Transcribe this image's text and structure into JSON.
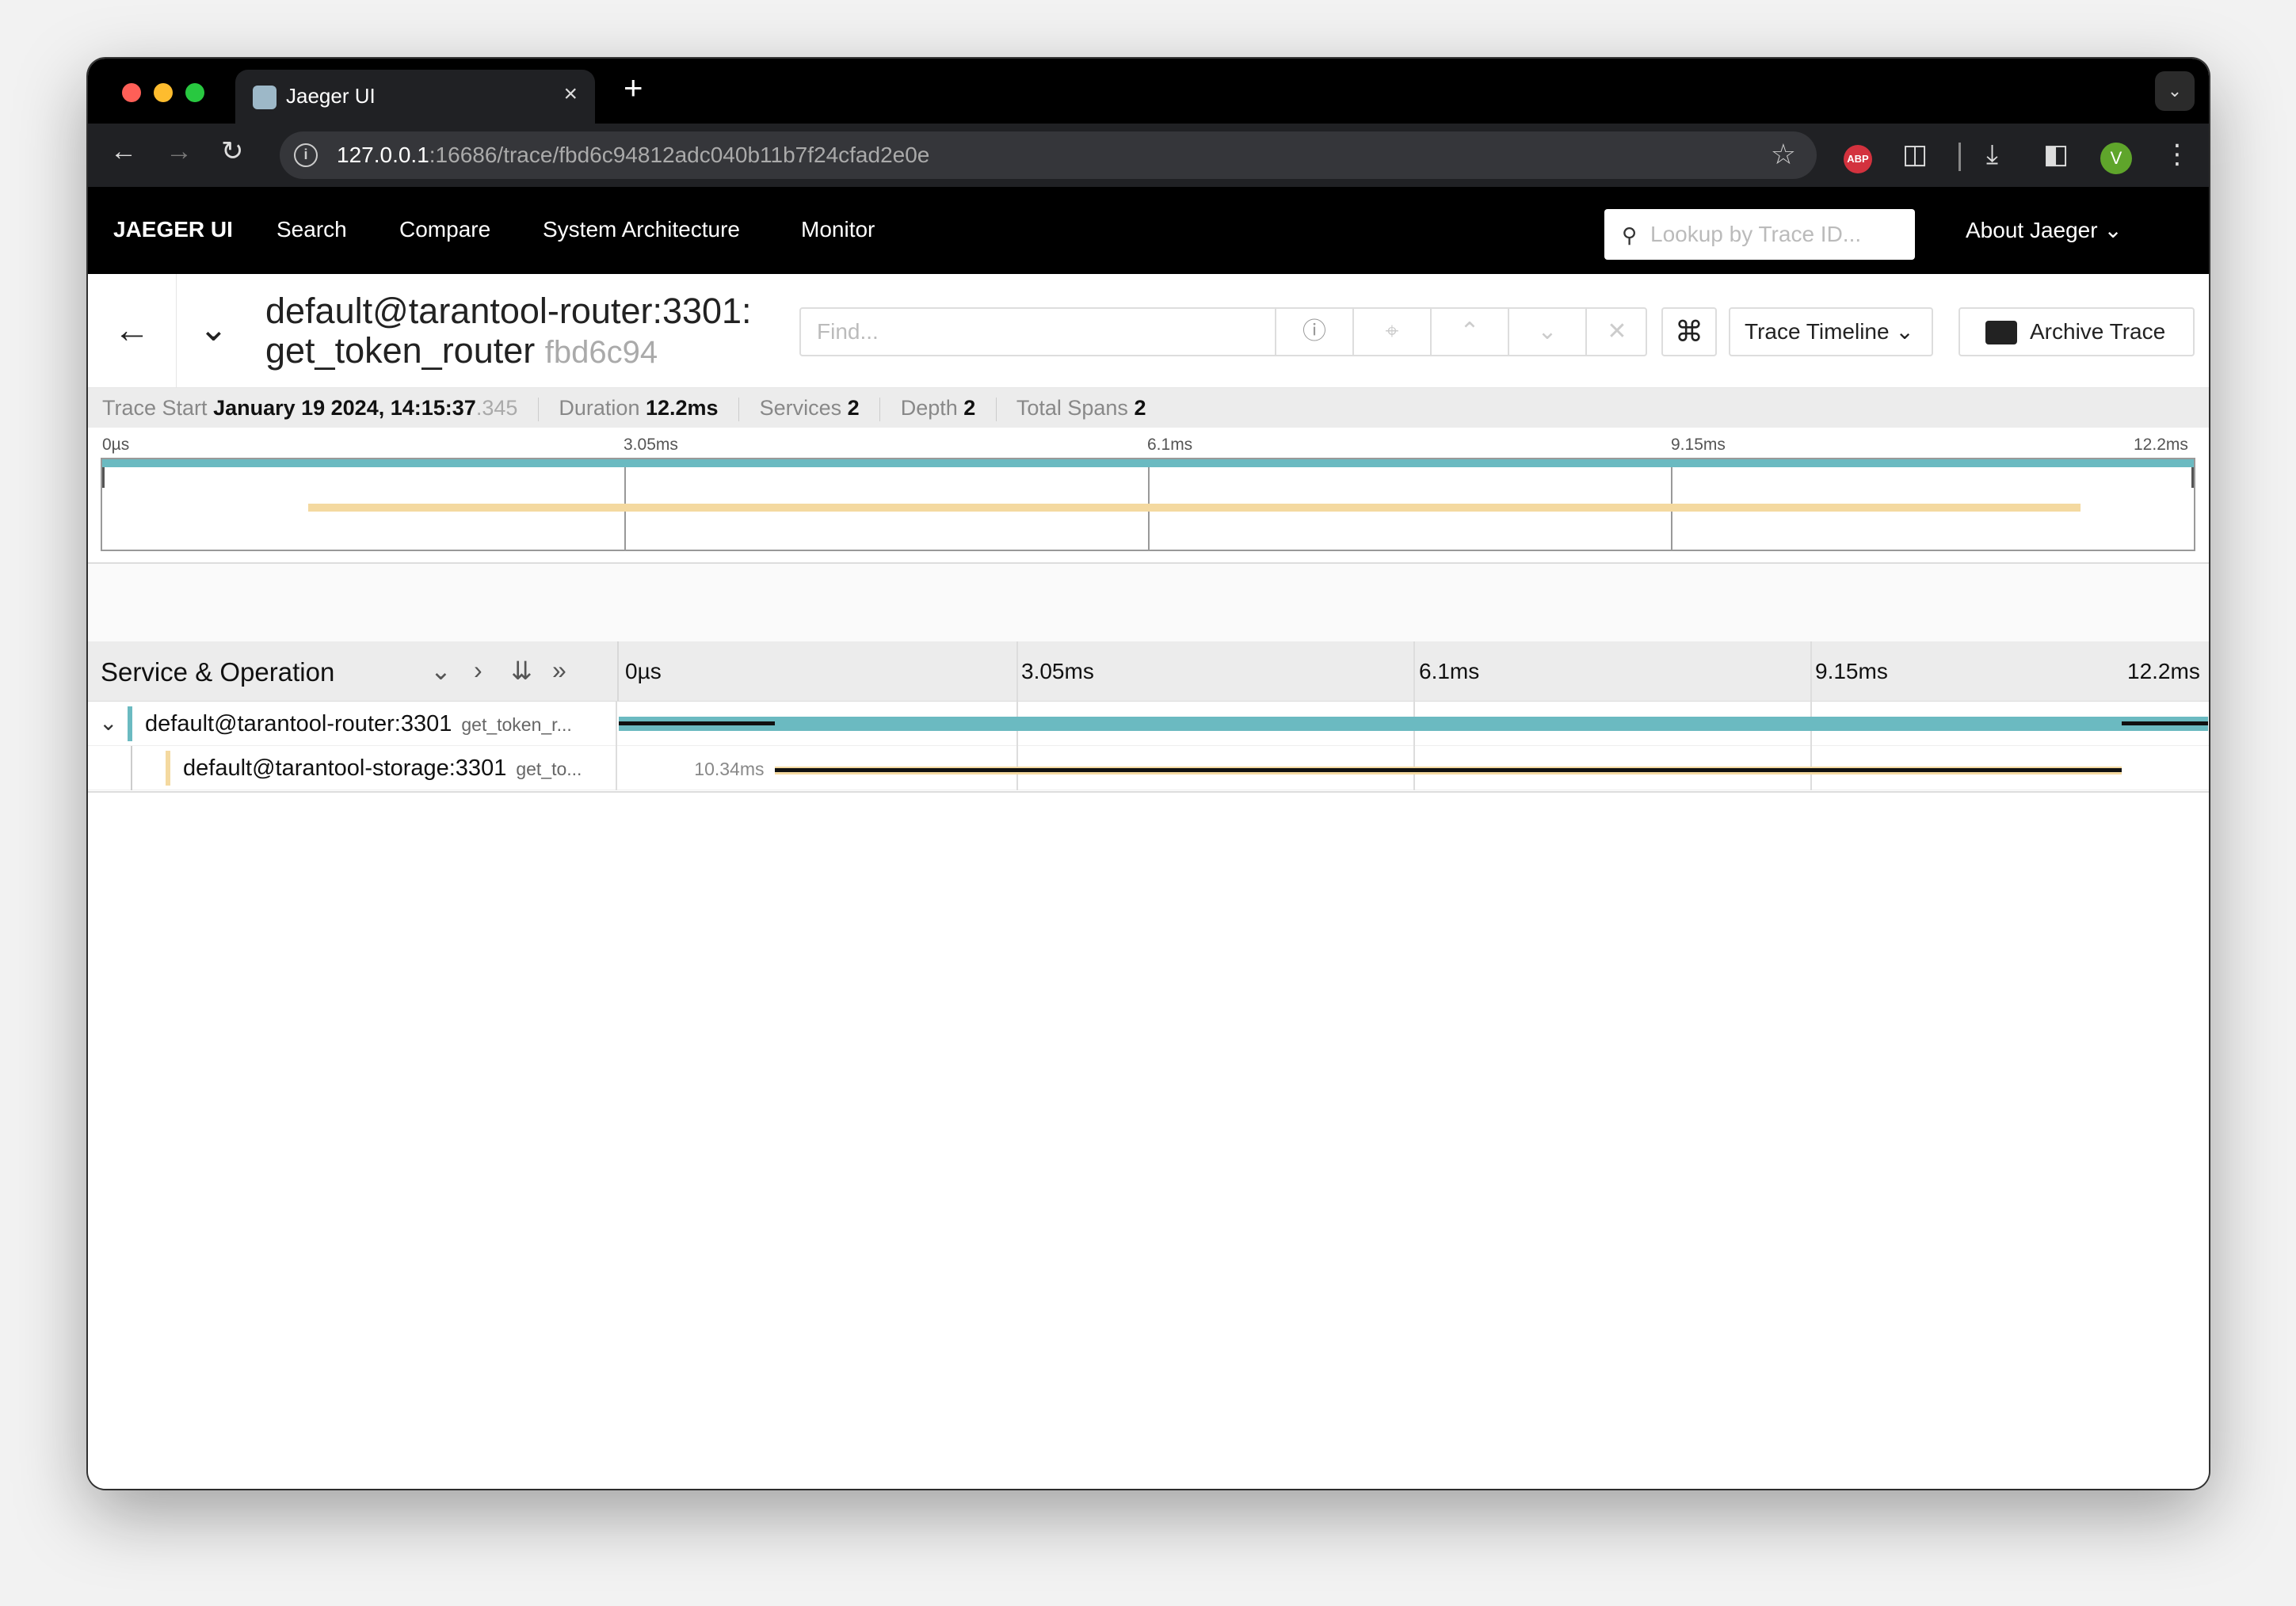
{
  "browser": {
    "tab_title": "Jaeger UI",
    "tab_close": "×",
    "new_tab": "+",
    "url_host": "127.0.0.1",
    "url_rest": ":16686/trace/fbd6c94812adc040b11b7f24cfad2e0e",
    "abp_label": "ABP",
    "profile_initial": "V"
  },
  "topnav": {
    "brand": "JAEGER UI",
    "items": [
      "Search",
      "Compare",
      "System Architecture",
      "Monitor"
    ],
    "lookup_placeholder": "Lookup by Trace ID...",
    "about": "About Jaeger"
  },
  "trace": {
    "title_line1": "default@tarantool-router:3301:",
    "title_line2": "get_token_router",
    "short_id": "fbd6c94",
    "find_placeholder": "Find...",
    "view_mode": "Trace Timeline",
    "archive_label": "Archive Trace"
  },
  "summary": {
    "trace_start_label": "Trace Start",
    "trace_start_value": "January 19 2024, 14:15:37",
    "trace_start_ms": ".345",
    "duration_label": "Duration",
    "duration_value": "12.2ms",
    "services_label": "Services",
    "services_value": "2",
    "depth_label": "Depth",
    "depth_value": "2",
    "total_spans_label": "Total Spans",
    "total_spans_value": "2"
  },
  "minimap": {
    "ticks": [
      "0µs",
      "3.05ms",
      "6.1ms",
      "9.15ms",
      "12.2ms"
    ]
  },
  "timeline": {
    "header_title": "Service & Operation",
    "ticks": [
      "0µs",
      "3.05ms",
      "6.1ms",
      "9.15ms",
      "12.2ms"
    ],
    "total_ms": 12.2,
    "spans": [
      {
        "service": "default@tarantool-router:3301",
        "operation": "get_token_r...",
        "start_ms": 0,
        "duration_ms": 12.2,
        "color": "#6bbac1",
        "label": ""
      },
      {
        "service": "default@tarantool-storage:3301",
        "operation": "get_to...",
        "start_ms": 1.2,
        "duration_ms": 10.34,
        "color": "#f4d9a0",
        "label": "10.34ms"
      }
    ]
  },
  "colors": {
    "router": "#6bbac1",
    "storage": "#f4d9a0"
  }
}
